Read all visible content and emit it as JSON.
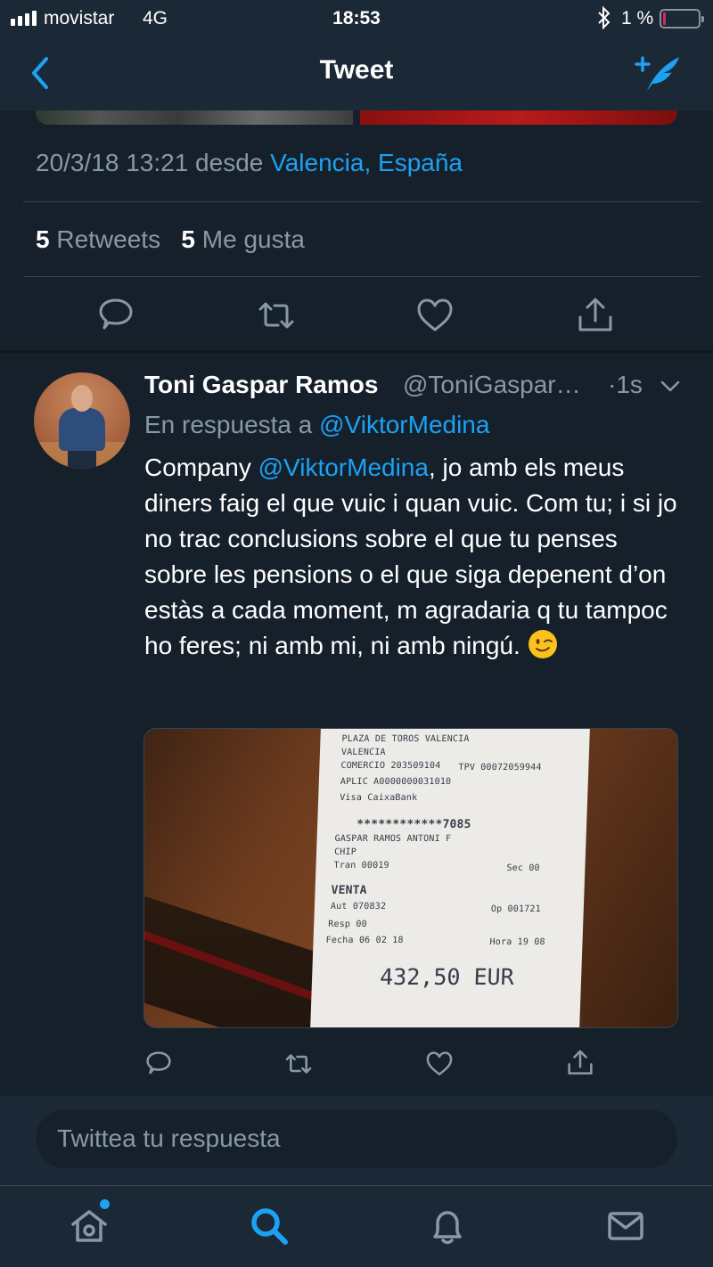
{
  "status_bar": {
    "carrier": "movistar",
    "network": "4G",
    "time": "18:53",
    "battery_pct": "1 %",
    "battery_level": 0.01
  },
  "header": {
    "title": "Tweet",
    "back_icon": "back-chevron-icon",
    "compose_icon": "compose-tweet-icon"
  },
  "main_tweet": {
    "datetime": "20/3/18 13:21 desde",
    "location": "Valencia, España",
    "retweets_count": "5",
    "retweets_label": "Retweets",
    "likes_count": "5",
    "likes_label": "Me gusta"
  },
  "reply": {
    "author_name": "Toni Gaspar Ramos",
    "author_handle": "@ToniGaspar…",
    "time": "·1s",
    "in_reply_prefix": "En respuesta a",
    "in_reply_to": "@ViktorMedina",
    "text_prefix": "Company",
    "text_mention": "@ViktorMedina",
    "text_body": ", jo amb els meus diners faig el que vuic i quan vuic. Com tu; i si jo no trac conclusions sobre el que tu penses sobre les pensions o el que siga depenent d’on estàs a cada moment, m agradaria q tu tampoc ho feres; ni amb mi, ni amb ningú.",
    "emoji": "winking-face",
    "receipt": {
      "line1": "PLAZA DE TOROS VALENCIA",
      "line2": "VALENCIA",
      "comercio": "COMERCIO  203509104",
      "tpv": "TPV  00072059944",
      "aplic": "APLIC   A0000000031010",
      "card_type": "Visa CaixaBank",
      "card_number": "************7085",
      "holder": "GASPAR RAMOS ANTONI F",
      "chip": "CHIP",
      "tran": "Tran 00019",
      "sec": "Sec 00",
      "venta": "VENTA",
      "aut": "Aut  070832",
      "op": "Op  001721",
      "resp": "Resp  00",
      "fecha": "Fecha 06 02 18",
      "hora": "Hora 19 08",
      "amount": "432,50 EUR"
    }
  },
  "composer": {
    "placeholder": "Twittea tu respuesta"
  },
  "tabs": [
    "home",
    "search",
    "notifications",
    "messages"
  ],
  "colors": {
    "accent": "#1da1f2",
    "background": "#15202b",
    "bar": "#1b2836",
    "muted_text": "#8899a6",
    "separator": "#38444d"
  }
}
